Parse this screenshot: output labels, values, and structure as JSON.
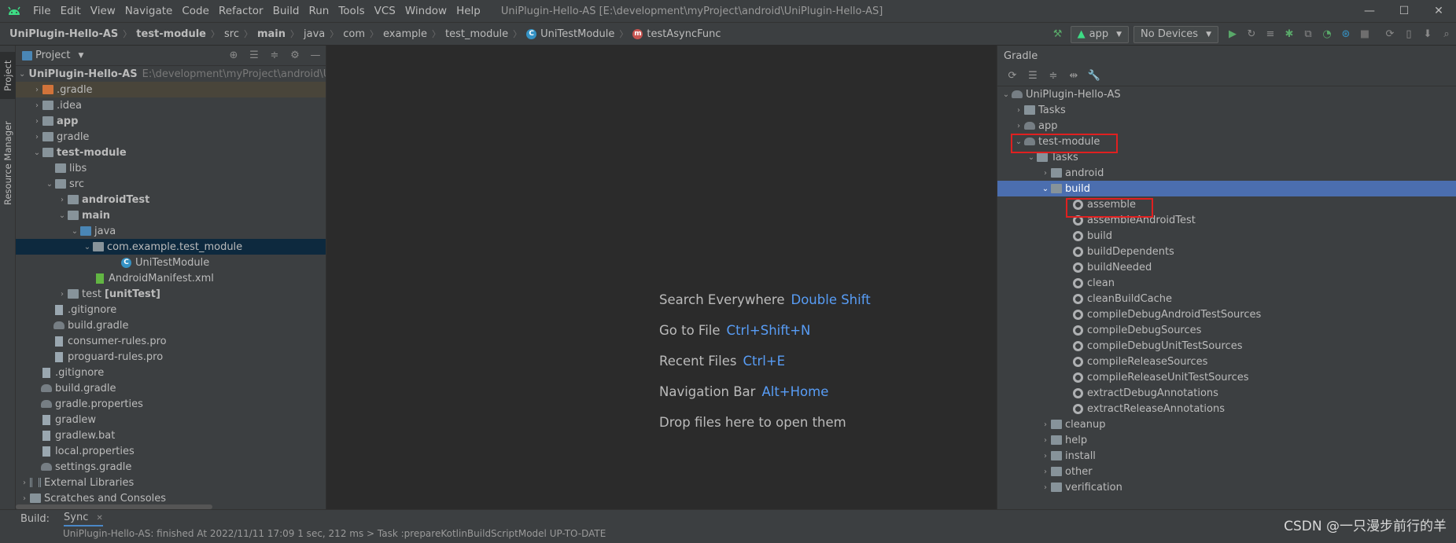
{
  "menu": {
    "items": [
      "File",
      "Edit",
      "View",
      "Navigate",
      "Code",
      "Refactor",
      "Build",
      "Run",
      "Tools",
      "VCS",
      "Window",
      "Help"
    ],
    "title": "UniPlugin-Hello-AS [E:\\development\\myProject\\android\\UniPlugin-Hello-AS]"
  },
  "breadcrumbs": [
    "UniPlugin-Hello-AS",
    "test-module",
    "src",
    "main",
    "java",
    "com",
    "example",
    "test_module",
    "UniTestModule",
    "testAsyncFunc"
  ],
  "toolbar": {
    "config": "app",
    "devices": "No Devices"
  },
  "stripe": {
    "project": "Project",
    "resource_manager": "Resource Manager"
  },
  "project_panel": {
    "title": "Project",
    "root_name": "UniPlugin-Hello-AS",
    "root_path": "E:\\development\\myProject\\android\\Un",
    "items": {
      "gradle_dir": ".gradle",
      "idea": ".idea",
      "app": "app",
      "gradle": "gradle",
      "test_module": "test-module",
      "libs": "libs",
      "src": "src",
      "android_test": "androidTest",
      "main": "main",
      "java": "java",
      "package": "com.example.test_module",
      "class": "UniTestModule",
      "manifest": "AndroidManifest.xml",
      "test": "test",
      "unit_test": "[unitTest]",
      "gitignore_mod": ".gitignore",
      "build_gradle_mod": "build.gradle",
      "consumer_rules": "consumer-rules.pro",
      "proguard_rules": "proguard-rules.pro",
      "gitignore": ".gitignore",
      "build_gradle": "build.gradle",
      "gradle_properties": "gradle.properties",
      "gradlew": "gradlew",
      "gradlew_bat": "gradlew.bat",
      "local_properties": "local.properties",
      "settings_gradle": "settings.gradle",
      "external_libraries": "External Libraries",
      "scratches": "Scratches and Consoles"
    }
  },
  "editor_hints": [
    {
      "label": "Search Everywhere",
      "key": "Double Shift"
    },
    {
      "label": "Go to File",
      "key": "Ctrl+Shift+N"
    },
    {
      "label": "Recent Files",
      "key": "Ctrl+E"
    },
    {
      "label": "Navigation Bar",
      "key": "Alt+Home"
    },
    {
      "label": "Drop files here to open them",
      "key": ""
    }
  ],
  "gradle_panel": {
    "title": "Gradle",
    "root": "UniPlugin-Hello-AS",
    "root_tasks": "Tasks",
    "app": "app",
    "module": "test-module",
    "module_tasks": "Tasks",
    "android": "android",
    "build_group": "build",
    "build_tasks": [
      "assemble",
      "assembleAndroidTest",
      "build",
      "buildDependents",
      "buildNeeded",
      "clean",
      "cleanBuildCache",
      "compileDebugAndroidTestSources",
      "compileDebugSources",
      "compileDebugUnitTestSources",
      "compileReleaseSources",
      "compileReleaseUnitTestSources",
      "extractDebugAnnotations",
      "extractReleaseAnnotations"
    ],
    "groups": [
      "cleanup",
      "help",
      "install",
      "other",
      "verification"
    ]
  },
  "bottom": {
    "build_label": "Build:",
    "sync_tab": "Sync",
    "status_line": "UniPlugin-Hello-AS: finished  At 2022/11/11 17:09  1 sec, 212 ms       > Task :prepareKotlinBuildScriptModel UP-TO-DATE"
  },
  "watermark": "CSDN @一只漫步前行的羊"
}
